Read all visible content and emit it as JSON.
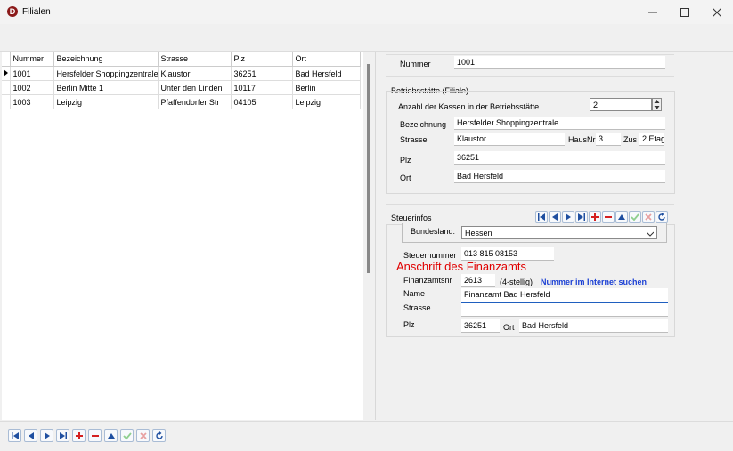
{
  "window": {
    "title": "Filialen",
    "app_icon_letter": "D"
  },
  "grid": {
    "columns": [
      "Nummer",
      "Bezeichnung",
      "Strasse",
      "Plz",
      "Ort"
    ],
    "rows": [
      [
        "1001",
        "Hersfelder Shoppingzentrale",
        "Klaustor",
        "36251",
        "Bad Hersfeld"
      ],
      [
        "1002",
        "Berlin Mitte 1",
        "Unter den Linden",
        "10117",
        "Berlin"
      ],
      [
        "1003",
        "Leipzig",
        "Pfaffendorfer Str",
        "04105",
        "Leipzig"
      ]
    ],
    "selected_row": 0
  },
  "form": {
    "nummer_label": "Nummer",
    "nummer_value": "1001",
    "betrieb_title": "Betriebsstätte (Filiale)",
    "kassen_label": "Anzahl der Kassen in der Betriebsstätte",
    "kassen_value": "2",
    "bezeichnung_label": "Bezeichnung",
    "bezeichnung_value": "Hersfelder Shoppingzentrale",
    "strasse_label": "Strasse",
    "strasse_value": "Klaustor",
    "hausnr_label": "HausNr",
    "hausnr_value": "3",
    "zus_label": "Zus",
    "zus_value": "2 Etag",
    "plz_label": "Plz",
    "plz_value": "36251",
    "ort_label": "Ort",
    "ort_value": "Bad Hersfeld"
  },
  "steuer": {
    "title": "Steuerinfos",
    "bundesland_label": "Bundesland:",
    "bundesland_value": "Hessen",
    "steuernummer_label": "Steuernummer",
    "steuernummer_value": "013 815 08153",
    "anschrift_heading": "Anschrift des Finanzamts",
    "finanzamtsnr_label": "Finanzamtsnr",
    "finanzamtsnr_value": "2613",
    "finanzamtsnr_hint": "(4-stellig)",
    "internet_link": "Nummer im Internet suchen",
    "name_label": "Name",
    "name_value": "Finanzamt Bad Hersfeld",
    "strasse_label": "Strasse",
    "strasse_value": "",
    "plz_label": "Plz",
    "plz_value": "36251",
    "ort_label": "Ort",
    "ort_value": "Bad Hersfeld"
  },
  "colors": {
    "accent": "#1a3fd4",
    "add": "#d42020",
    "confirm": "#5cb85c",
    "cancel": "#e06060",
    "highlight": "#e00000"
  }
}
